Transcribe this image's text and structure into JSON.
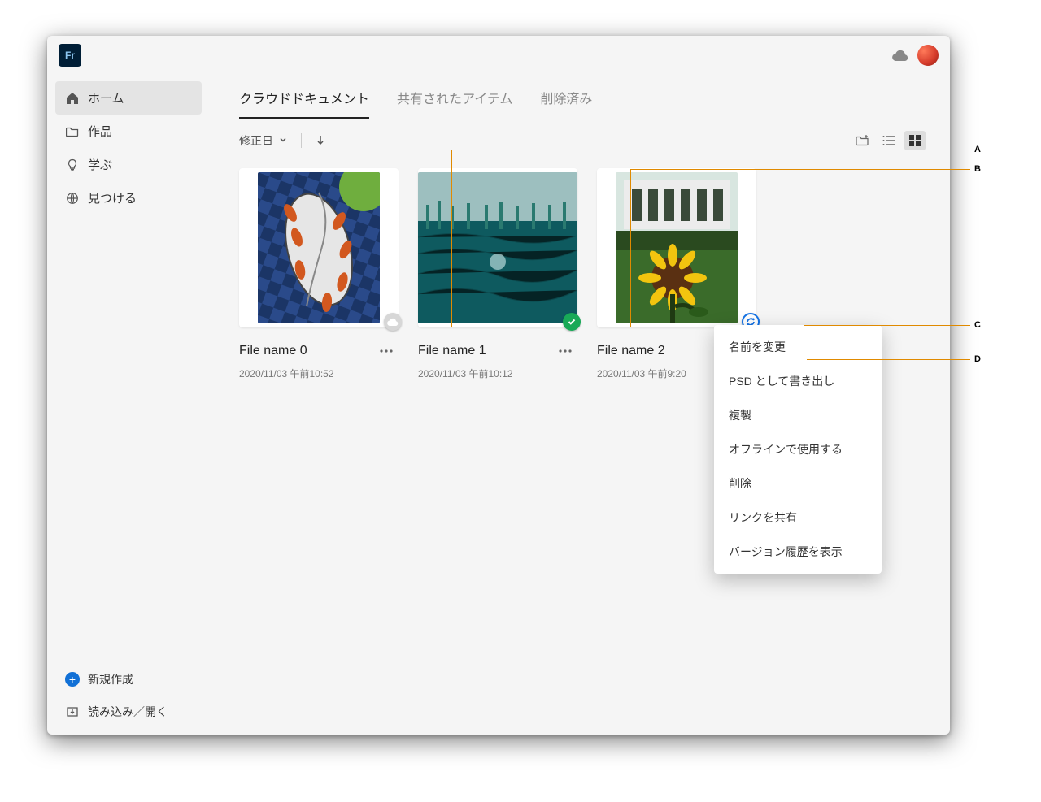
{
  "app_logo_text": "Fr",
  "sidebar": {
    "items": [
      {
        "label": "ホーム",
        "icon": "home-icon",
        "active": true
      },
      {
        "label": "作品",
        "icon": "folder-icon",
        "active": false
      },
      {
        "label": "学ぶ",
        "icon": "lightbulb-icon",
        "active": false
      },
      {
        "label": "見つける",
        "icon": "globe-icon",
        "active": false
      }
    ],
    "actions": {
      "new": "新規作成",
      "import": "読み込み／開く"
    }
  },
  "tabs": [
    {
      "label": "クラウドドキュメント",
      "active": true
    },
    {
      "label": "共有されたアイテム",
      "active": false
    },
    {
      "label": "削除済み",
      "active": false
    }
  ],
  "sort": {
    "label": "修正日"
  },
  "files": [
    {
      "name": "File name 0",
      "timestamp": "2020/11/03 午前10:52",
      "status": "cloud"
    },
    {
      "name": "File name 1",
      "timestamp": "2020/11/03 午前10:12",
      "status": "ok"
    },
    {
      "name": "File name 2",
      "timestamp": "2020/11/03 午前9:20",
      "status": "sync",
      "menu_open": true
    }
  ],
  "context_menu": [
    "名前を変更",
    "PSD として書き出し",
    "複製",
    "オフラインで使用する",
    "削除",
    "リンクを共有",
    "バージョン履歴を表示"
  ],
  "callouts": {
    "a": "A",
    "b": "B",
    "c": "C",
    "d": "D"
  }
}
